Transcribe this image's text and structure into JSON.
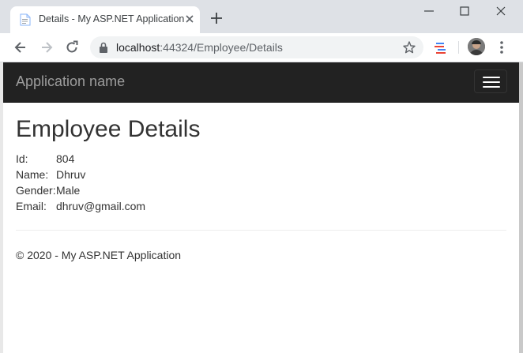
{
  "browser": {
    "tab_title": "Details - My ASP.NET Application",
    "url_host": "localhost",
    "url_rest": ":44324/Employee/Details"
  },
  "navbar": {
    "brand": "Application name"
  },
  "page": {
    "heading": "Employee Details",
    "fields": [
      {
        "label": "Id:",
        "value": "804"
      },
      {
        "label": "Name:",
        "value": "Dhruv"
      },
      {
        "label": "Gender:",
        "value": "Male"
      },
      {
        "label": "Email:",
        "value": "dhruv@gmail.com"
      }
    ],
    "footer": "© 2020 - My ASP.NET Application"
  }
}
